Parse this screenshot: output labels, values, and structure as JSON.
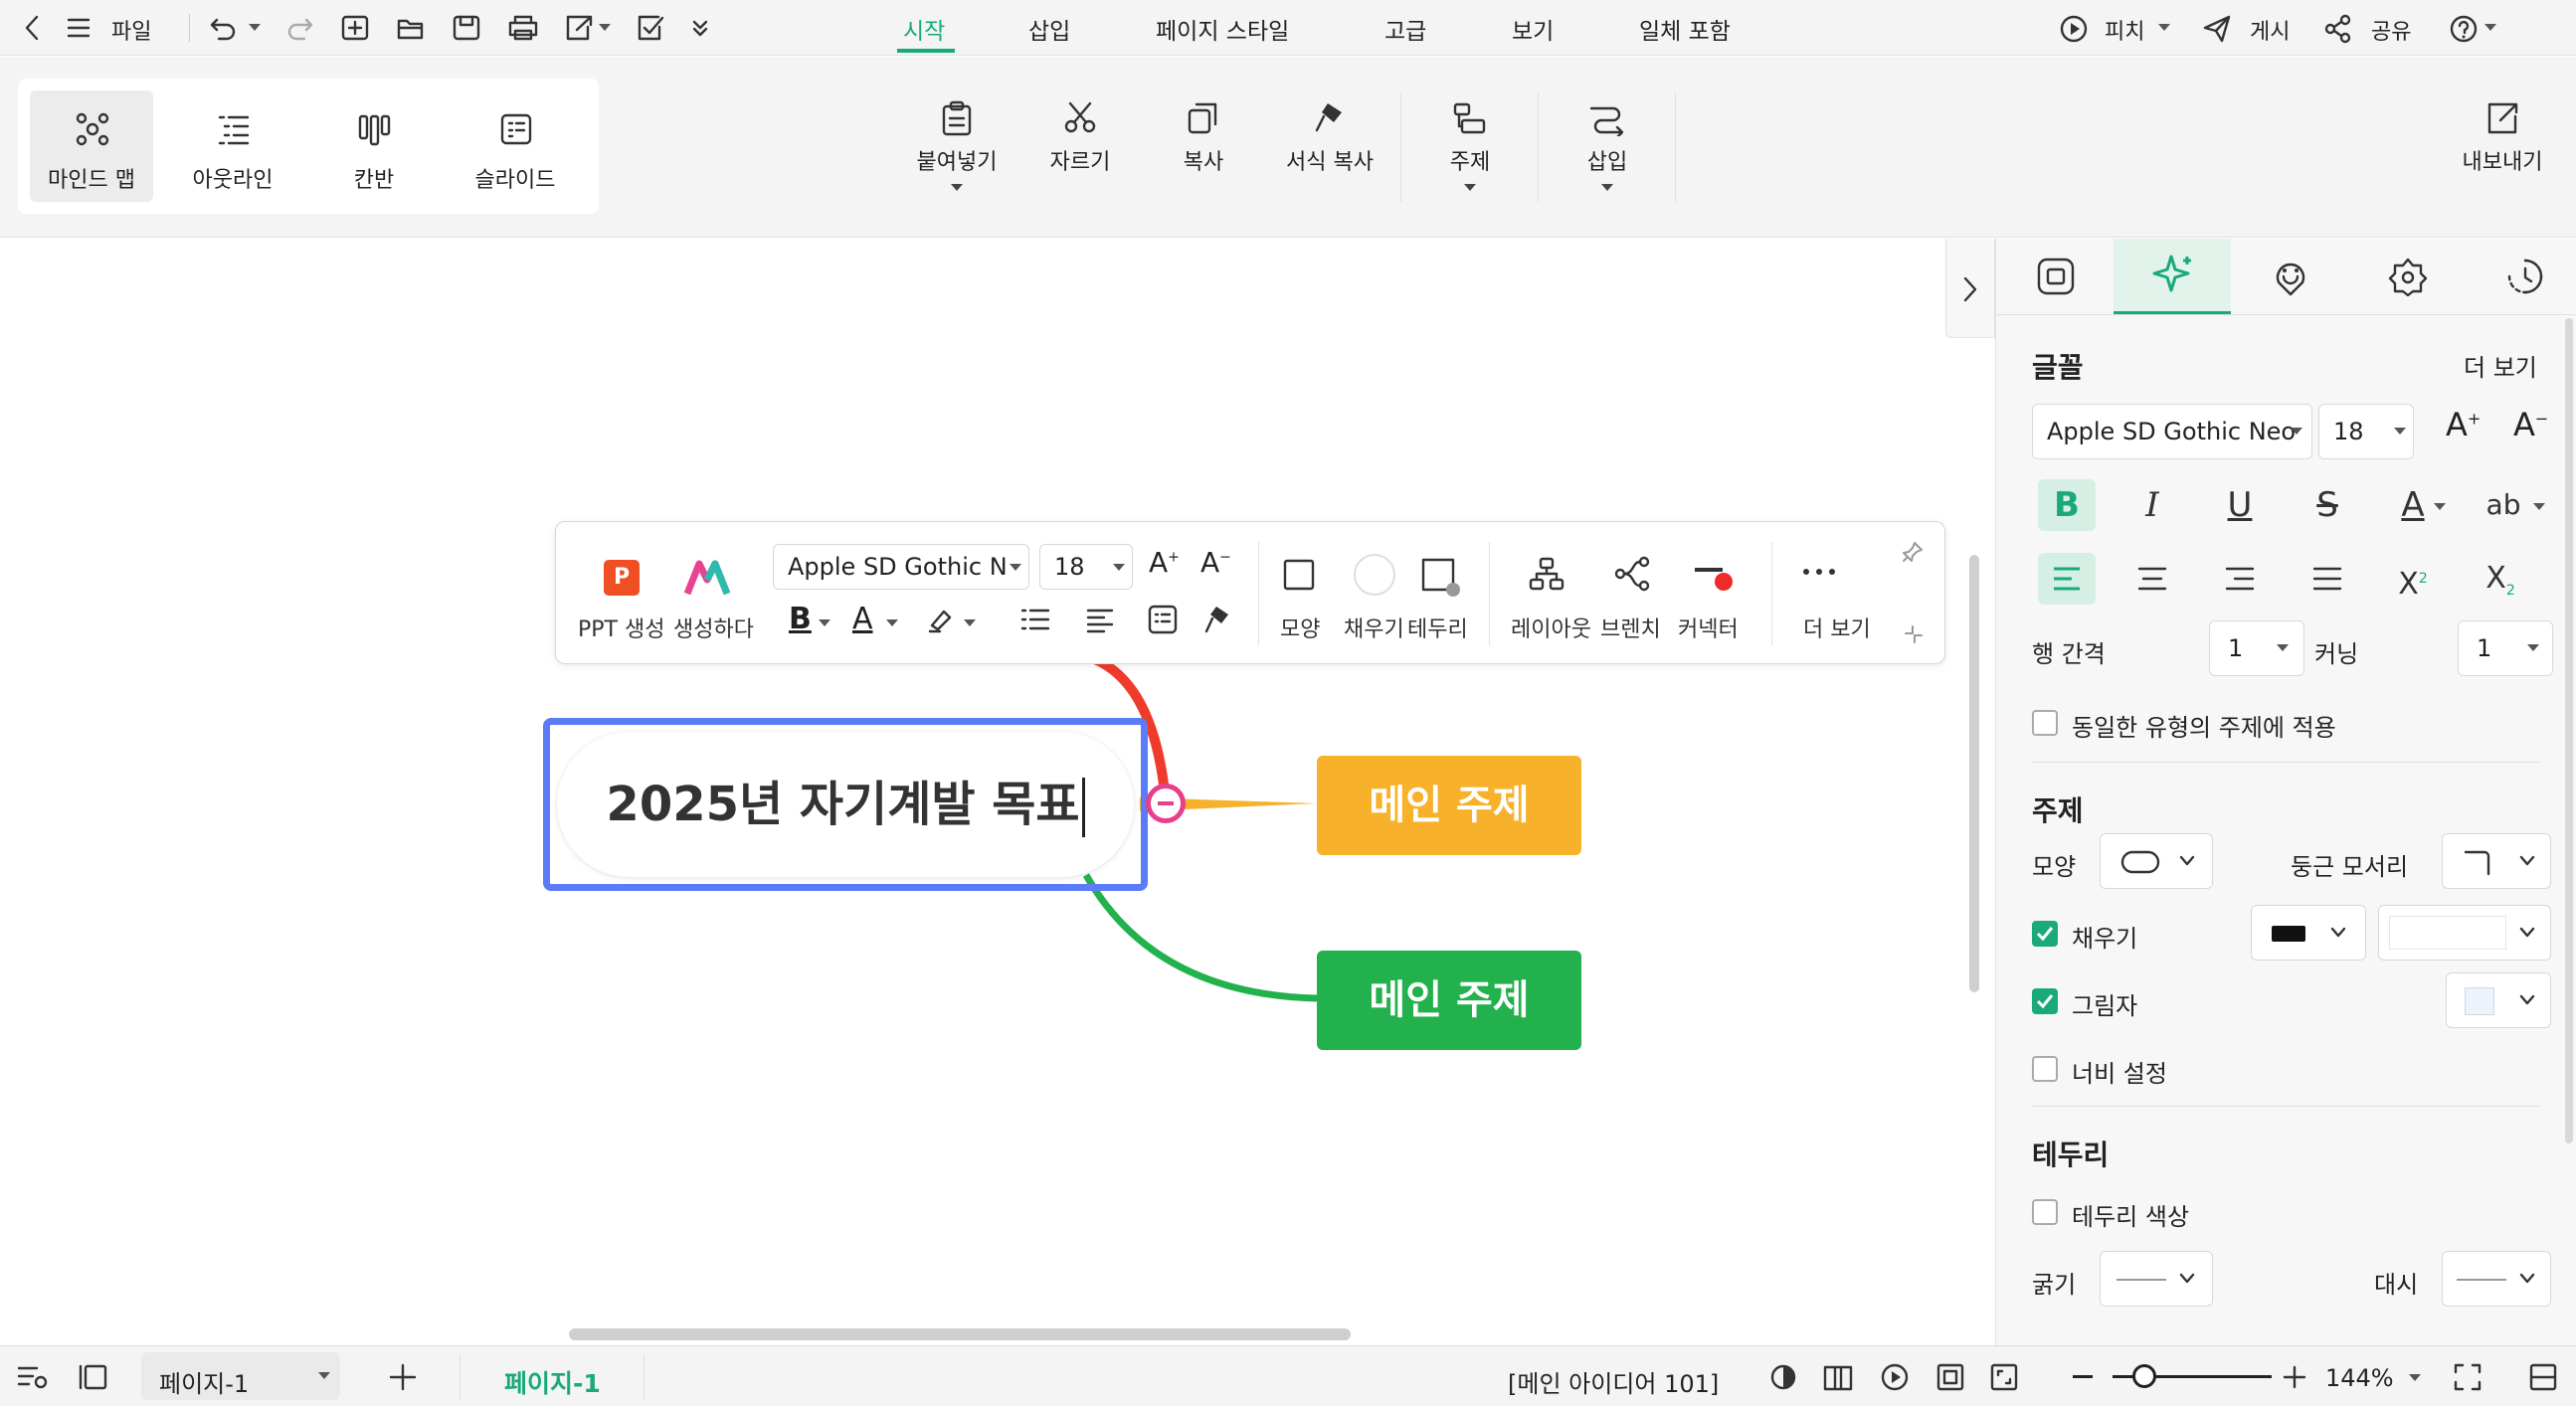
{
  "topbar": {
    "file_label": "파일",
    "tabs": [
      "시작",
      "삽입",
      "페이지 스타일",
      "고급",
      "보기",
      "일체 포함"
    ],
    "active_tab": "시작",
    "pitch_label": "피치",
    "publish_label": "게시",
    "share_label": "공유"
  },
  "ribbon": {
    "views": [
      {
        "label": "마인드 맵",
        "icon": "mindmap-icon",
        "selected": true
      },
      {
        "label": "아웃라인",
        "icon": "outline-icon",
        "selected": false
      },
      {
        "label": "칸반",
        "icon": "kanban-icon",
        "selected": false
      },
      {
        "label": "슬라이드",
        "icon": "slide-icon",
        "selected": false
      }
    ],
    "paste": "붙여넣기",
    "cut": "자르기",
    "copy": "복사",
    "format_copy": "서식 복사",
    "topic": "주제",
    "insert": "삽입",
    "export": "내보내기"
  },
  "float_toolbar": {
    "ppt": "PPT 생성",
    "generate": "생성하다",
    "font": "Apple SD Gothic N",
    "size": "18",
    "shape": "모양",
    "fill": "채우기",
    "border": "테두리",
    "layout": "레이아웃",
    "branch": "브렌치",
    "connector": "커넥터",
    "more": "더 보기"
  },
  "mindmap": {
    "central": "2025년 자기계발 목표",
    "topic1": "메인 주제",
    "topic2": "메인 주제",
    "colors": {
      "orange": "#f7b12b",
      "green": "#22b14c",
      "red": "#ee3b2b",
      "selection": "#5b7cf6",
      "collapse": "#e83e8c"
    }
  },
  "panel": {
    "font_section": "글꼴",
    "more": "더 보기",
    "font_name": "Apple SD Gothic Neo",
    "font_size": "18",
    "bold": "B",
    "italic": "I",
    "underline": "U",
    "strike": "S",
    "fontcolor": "A",
    "case": "ab",
    "line_spacing_label": "행 간격",
    "line_spacing": "1",
    "kerning_label": "커닝",
    "kerning": "1",
    "apply_same": "동일한 유형의 주제에 적용",
    "topic_section": "주제",
    "shape_label": "모양",
    "corner_label": "둥근 모서리",
    "fill_label": "채우기",
    "shadow_label": "그림자",
    "width_label": "너비 설정",
    "border_section": "테두리",
    "border_color_label": "테두리 색상",
    "thickness_label": "굵기",
    "dash_label": "대시"
  },
  "status": {
    "page_selector": "페이지-1",
    "active_page": "페이지-1",
    "info": "[메인 아이디어 101]",
    "zoom": "144%"
  }
}
